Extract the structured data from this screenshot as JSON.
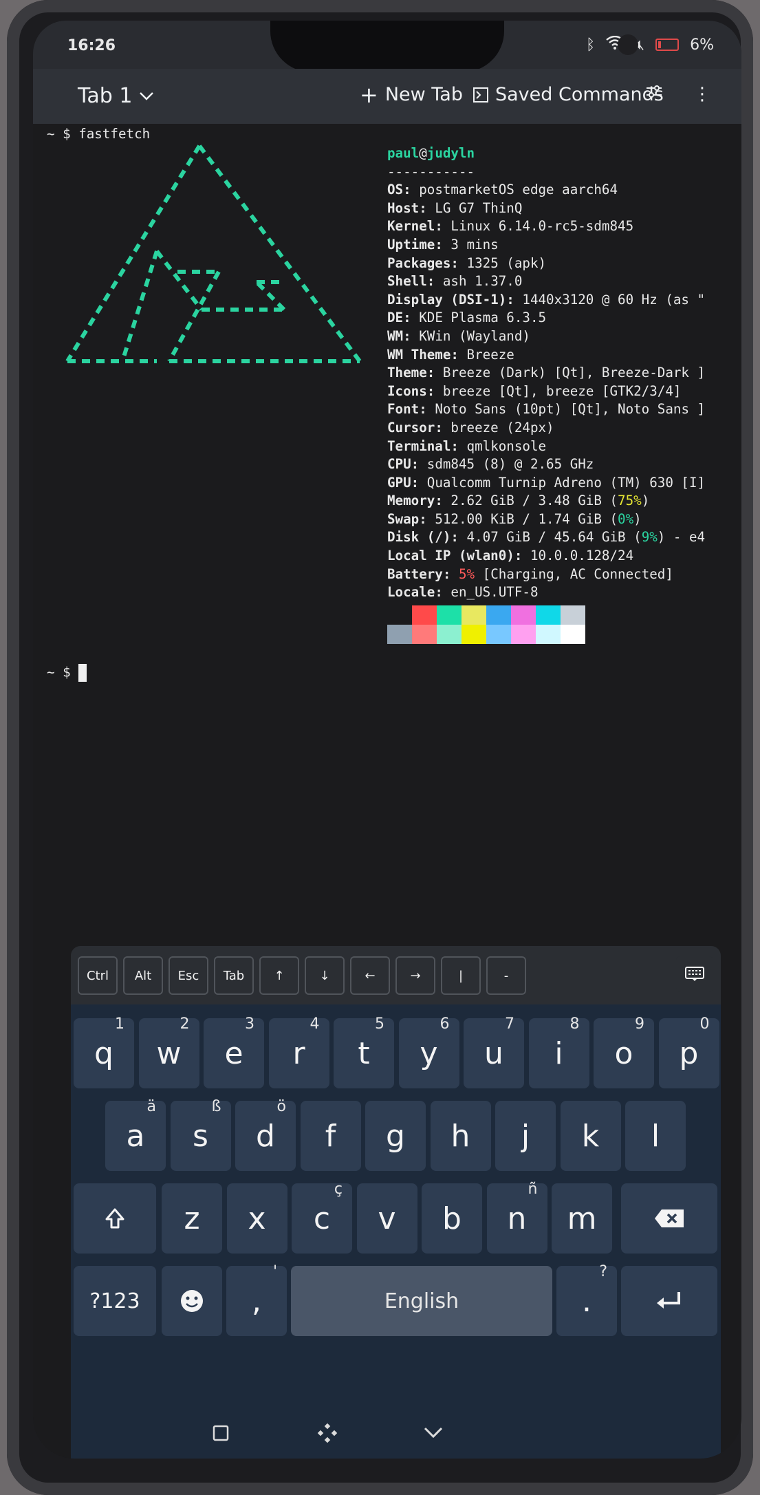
{
  "status": {
    "time": "16:26",
    "battery": "6%"
  },
  "toolbar": {
    "tab": "Tab 1",
    "new_tab": "New Tab",
    "saved": "Saved Commands"
  },
  "terminal": {
    "prompt_cmd": "~ $ fastfetch",
    "prompt2": "~ $",
    "user": "paul",
    "at": "@",
    "host": "judyln",
    "sep": "-----------",
    "rows": [
      {
        "k": "OS",
        "v": " postmarketOS edge aarch64"
      },
      {
        "k": "Host",
        "v": " LG G7 ThinQ"
      },
      {
        "k": "Kernel",
        "v": " Linux 6.14.0-rc5-sdm845"
      },
      {
        "k": "Uptime",
        "v": " 3 mins"
      },
      {
        "k": "Packages",
        "v": " 1325 (apk)"
      },
      {
        "k": "Shell",
        "v": " ash 1.37.0"
      },
      {
        "k": "Display (DSI-1)",
        "v": " 1440x3120 @ 60 Hz (as \""
      },
      {
        "k": "DE",
        "v": " KDE Plasma 6.3.5"
      },
      {
        "k": "WM",
        "v": " KWin (Wayland)"
      },
      {
        "k": "WM Theme",
        "v": " Breeze"
      },
      {
        "k": "Theme",
        "v": " Breeze (Dark) [Qt], Breeze-Dark ]"
      },
      {
        "k": "Icons",
        "v": " breeze [Qt], breeze [GTK2/3/4]"
      },
      {
        "k": "Font",
        "v": " Noto Sans (10pt) [Qt], Noto Sans ]"
      },
      {
        "k": "Cursor",
        "v": " breeze (24px)"
      },
      {
        "k": "Terminal",
        "v": " qmlkonsole"
      },
      {
        "k": "CPU",
        "v": " sdm845 (8) @ 2.65 GHz"
      },
      {
        "k": "GPU",
        "v": " Qualcomm Turnip Adreno (TM) 630 [I]"
      },
      {
        "k": "Memory",
        "v": " 2.62 GiB / 3.48 GiB (",
        "p": "75%",
        "pc": "pct-y",
        "t": ")"
      },
      {
        "k": "Swap",
        "v": " 512.00 KiB / 1.74 GiB (",
        "p": "0%",
        "pc": "pct-g",
        "t": ")"
      },
      {
        "k": "Disk (/)",
        "v": " 4.07 GiB / 45.64 GiB (",
        "p": "9%",
        "pc": "pct-g",
        "t": ") - e4"
      },
      {
        "k": "Local IP (wlan0)",
        "v": " 10.0.0.128/24"
      },
      {
        "k": "Battery",
        "v": " ",
        "p": "5%",
        "pc": "pct-r",
        "t": " [Charging, AC Connected]"
      },
      {
        "k": "Locale",
        "v": " en_US.UTF-8"
      }
    ],
    "palette_top": [
      "#1b1b1d",
      "#ff4a4a",
      "#1de0a8",
      "#e8e860",
      "#3aa8f0",
      "#f070e0",
      "#10d8e8",
      "#c8d0d8"
    ],
    "palette_bottom": [
      "#8fa0b0",
      "#ff7a7a",
      "#8cf0d0",
      "#f0f000",
      "#78c8ff",
      "#ffa0f0",
      "#d0f8ff",
      "#ffffff"
    ]
  },
  "extra_keys": [
    "Ctrl",
    "Alt",
    "Esc",
    "Tab",
    "↑",
    "↓",
    "←",
    "→",
    "|",
    "-"
  ],
  "keyboard": {
    "row1": [
      {
        "k": "q",
        "h": "1"
      },
      {
        "k": "w",
        "h": "2"
      },
      {
        "k": "e",
        "h": "3"
      },
      {
        "k": "r",
        "h": "4"
      },
      {
        "k": "t",
        "h": "5"
      },
      {
        "k": "y",
        "h": "6"
      },
      {
        "k": "u",
        "h": "7"
      },
      {
        "k": "i",
        "h": "8"
      },
      {
        "k": "o",
        "h": "9"
      },
      {
        "k": "p",
        "h": "0"
      }
    ],
    "row2": [
      {
        "k": "a",
        "h": "ä"
      },
      {
        "k": "s",
        "h": "ß"
      },
      {
        "k": "d",
        "h": "ö"
      },
      {
        "k": "f",
        "h": ""
      },
      {
        "k": "g",
        "h": ""
      },
      {
        "k": "h",
        "h": ""
      },
      {
        "k": "j",
        "h": ""
      },
      {
        "k": "k",
        "h": ""
      },
      {
        "k": "l",
        "h": ""
      }
    ],
    "row3": [
      {
        "k": "z",
        "h": ""
      },
      {
        "k": "x",
        "h": ""
      },
      {
        "k": "c",
        "h": "ç"
      },
      {
        "k": "v",
        "h": ""
      },
      {
        "k": "b",
        "h": ""
      },
      {
        "k": "n",
        "h": "ñ"
      },
      {
        "k": "m",
        "h": ""
      }
    ],
    "symbols": "?123",
    "comma": ",",
    "space": "English",
    "period": ".",
    "period_hint": "?",
    "comma_hint": "'"
  }
}
